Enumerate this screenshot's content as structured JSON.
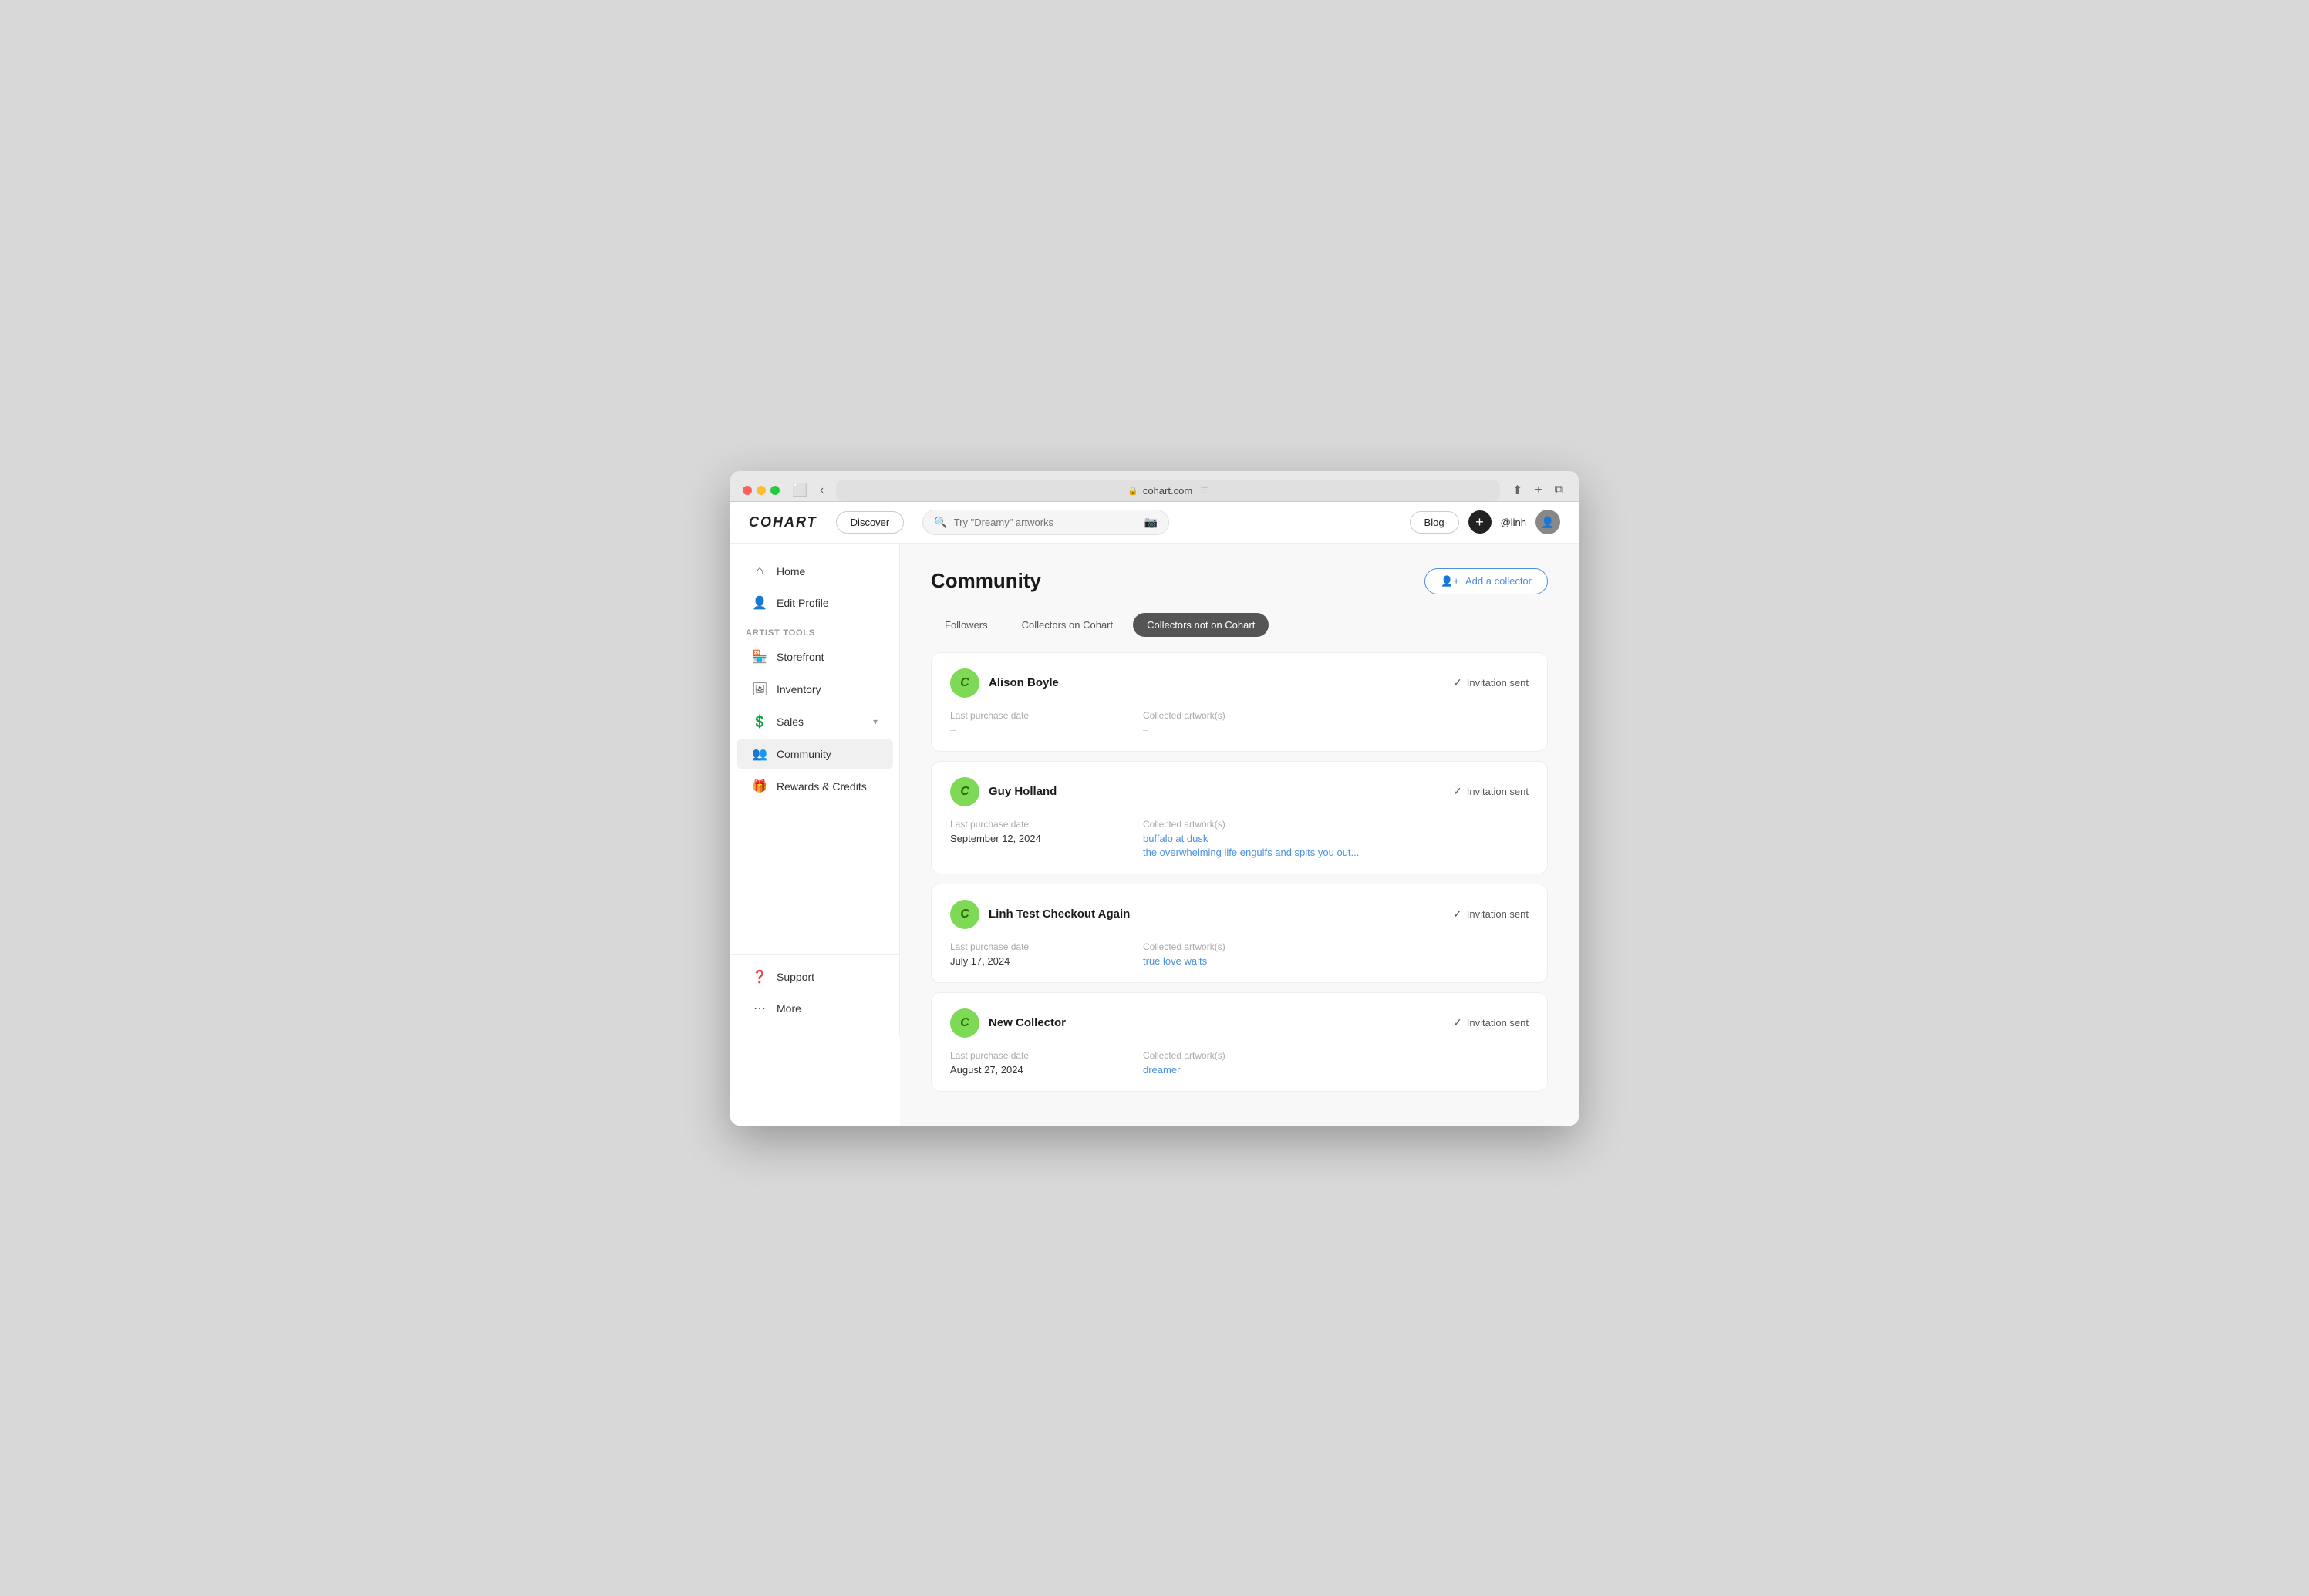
{
  "browser": {
    "url": "cohart.com",
    "lock_icon": "🔒"
  },
  "nav": {
    "logo": "COHART",
    "discover_label": "Discover",
    "search_placeholder": "Try \"Dreamy\" artworks",
    "blog_label": "Blog",
    "plus_symbol": "+",
    "username": "@linh"
  },
  "sidebar": {
    "home_label": "Home",
    "edit_profile_label": "Edit Profile",
    "artist_tools_section": "ARTIST TOOLS",
    "storefront_label": "Storefront",
    "inventory_label": "Inventory",
    "sales_label": "Sales",
    "community_label": "Community",
    "rewards_label": "Rewards & Credits",
    "support_label": "Support",
    "more_label": "More"
  },
  "page": {
    "title": "Community",
    "add_collector_label": "Add a collector",
    "tabs": [
      {
        "id": "followers",
        "label": "Followers"
      },
      {
        "id": "collectors-on-cohart",
        "label": "Collectors on Cohart"
      },
      {
        "id": "collectors-not-on-cohart",
        "label": "Collectors not on Cohart",
        "active": true
      }
    ],
    "collectors": [
      {
        "id": 1,
        "name": "Alison Boyle",
        "invitation_status": "Invitation sent",
        "last_purchase_date": "–",
        "collected_artworks": []
      },
      {
        "id": 2,
        "name": "Guy Holland",
        "invitation_status": "Invitation sent",
        "last_purchase_date": "September 12, 2024",
        "collected_artworks": [
          "buffalo at dusk",
          "the overwhelming life engulfs and spits you out..."
        ]
      },
      {
        "id": 3,
        "name": "Linh Test Checkout Again",
        "invitation_status": "Invitation sent",
        "last_purchase_date": "July 17, 2024",
        "collected_artworks": [
          "true love waits"
        ]
      },
      {
        "id": 4,
        "name": "New Collector",
        "invitation_status": "Invitation sent",
        "last_purchase_date": "August 27, 2024",
        "collected_artworks": [
          "dreamer"
        ]
      }
    ],
    "field_labels": {
      "last_purchase_date": "Last purchase date",
      "collected_artworks": "Collected artwork(s)"
    }
  }
}
